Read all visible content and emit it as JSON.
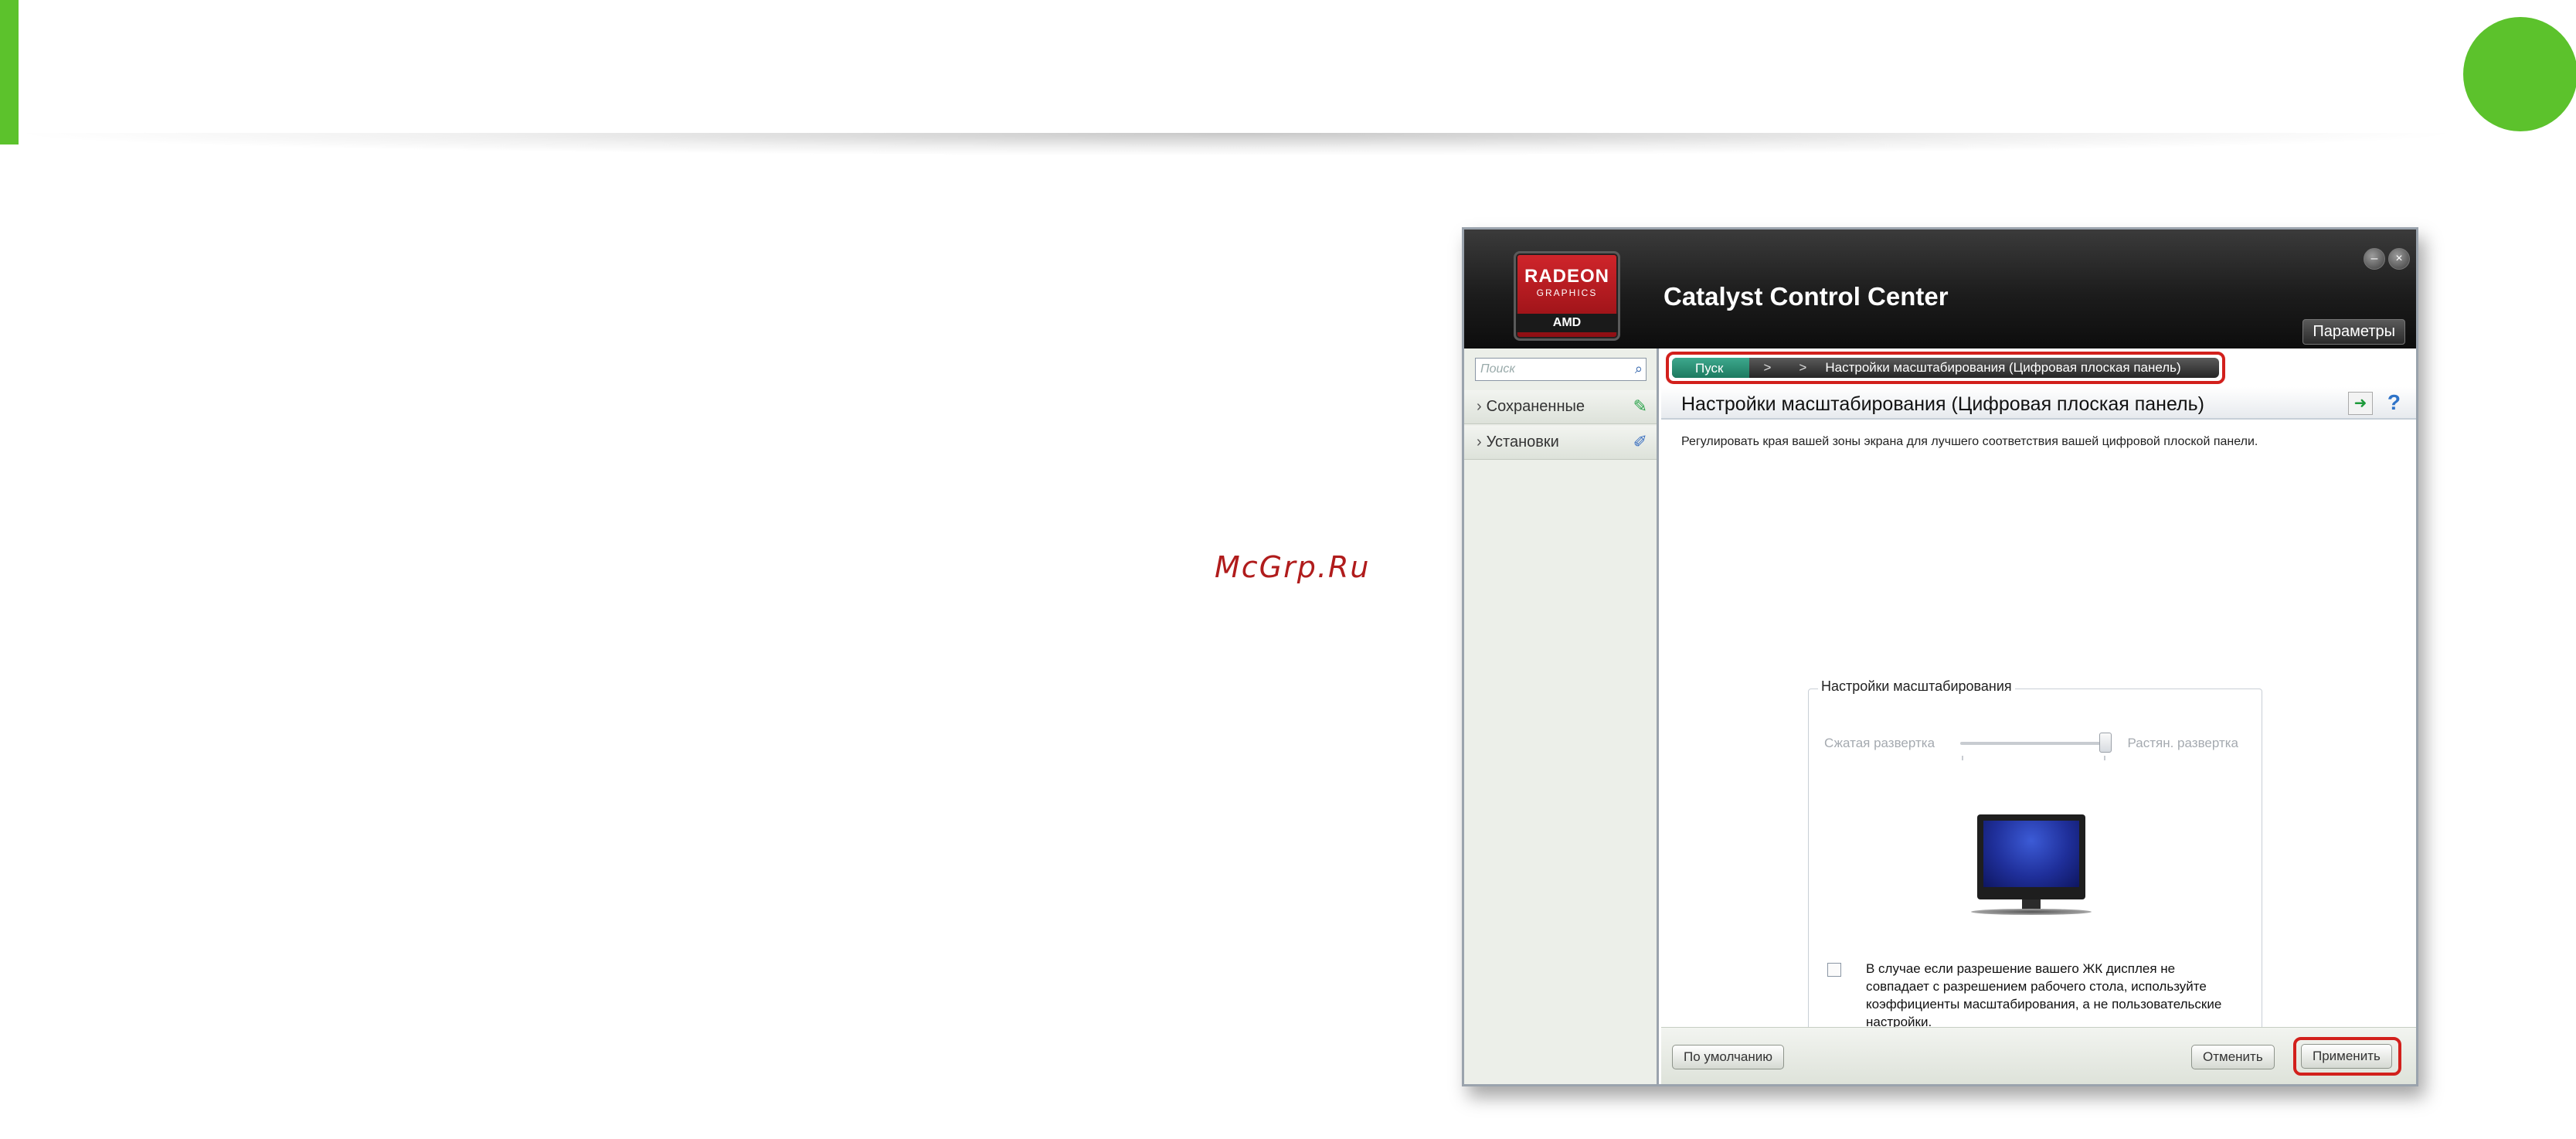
{
  "watermark": "McGrp.Ru",
  "window": {
    "app_title": "Catalyst Control Center",
    "logo": {
      "line1": "RADEON",
      "line2": "GRAPHICS",
      "line3": "AMD"
    },
    "minimize_glyph": "–",
    "close_glyph": "×",
    "params_label": "Параметры"
  },
  "sidebar": {
    "search_placeholder": "Поиск",
    "items": [
      {
        "label": "Сохраненные",
        "icon": "pin-icon"
      },
      {
        "label": "Установки",
        "icon": "tools-icon"
      }
    ]
  },
  "breadcrumb": {
    "home": "Пуск",
    "sep1": ">",
    "sep2": ">",
    "current": "Настройки масштабирования (Цифровая плоская панель)"
  },
  "page": {
    "title": "Настройки масштабирования (Цифровая плоская панель)",
    "help": "?",
    "description": "Регулировать края вашей зоны экрана для лучшего соответствия вашей цифровой плоской панели."
  },
  "scaling_group": {
    "title": "Настройки масштабирования",
    "slider_left_label": "Сжатая развертка",
    "slider_right_label": "Растян. развертка",
    "slider_value_fraction": 1.0,
    "checkbox_label": "В случае если разрешение вашего ЖК дисплея не совпадает с разрешением рабочего стола, используйте коэффициенты масштабирования, а не пользовательские настройки.",
    "checkbox_checked": false
  },
  "footer": {
    "default_label": "По умолчанию",
    "cancel_label": "Отменить",
    "apply_label": "Применить"
  },
  "colors": {
    "accent_green": "#5cc22c",
    "highlight_red": "#d2201c",
    "breadcrumb_home": "#1d7a60"
  }
}
